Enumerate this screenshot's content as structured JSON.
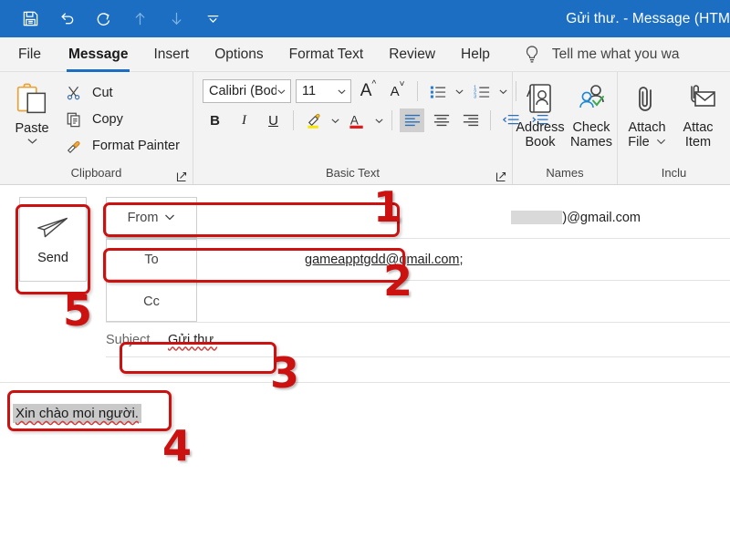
{
  "window": {
    "title": "Gửi thư.  -  Message (HTM",
    "titlebar_color": "#1b6ec2",
    "quick_access": [
      {
        "name": "save-icon",
        "label": "Save"
      },
      {
        "name": "undo-icon",
        "label": "Undo"
      },
      {
        "name": "redo-icon",
        "label": "Redo"
      },
      {
        "name": "previous-item-icon",
        "label": "Previous Item"
      },
      {
        "name": "next-item-icon",
        "label": "Next Item"
      },
      {
        "name": "customize-quick-access-toolbar-icon",
        "label": "Customize Quick Access Toolbar"
      }
    ]
  },
  "tabs": [
    {
      "label": "File",
      "active": false
    },
    {
      "label": "Message",
      "active": true
    },
    {
      "label": "Insert",
      "active": false
    },
    {
      "label": "Options",
      "active": false
    },
    {
      "label": "Format Text",
      "active": false
    },
    {
      "label": "Review",
      "active": false
    },
    {
      "label": "Help",
      "active": false
    }
  ],
  "tellme": {
    "placeholder": "Tell me what you wa",
    "icon": "lightbulb-icon"
  },
  "ribbon": {
    "groups": [
      {
        "label": "Clipboard",
        "has_launcher": true,
        "paste": {
          "label": "Paste",
          "icon": "clipboard-icon"
        },
        "items": [
          {
            "label": "Cut",
            "icon": "scissors-icon"
          },
          {
            "label": "Copy",
            "icon": "copy-icon"
          },
          {
            "label": "Format Painter",
            "icon": "paintbrush-icon"
          }
        ]
      },
      {
        "label": "Basic Text",
        "has_launcher": true,
        "font_name": "Calibri (Bod",
        "font_size": "11",
        "buttons": [
          {
            "name": "grow-font-button",
            "label": "A"
          },
          {
            "name": "shrink-font-button",
            "label": "A"
          },
          {
            "name": "bullets-button",
            "label": ""
          },
          {
            "name": "numbering-button",
            "label": ""
          },
          {
            "name": "clear-formatting-button",
            "label": "A"
          },
          {
            "name": "bold-button",
            "label": "B"
          },
          {
            "name": "italic-button",
            "label": "I"
          },
          {
            "name": "underline-button",
            "label": "U"
          },
          {
            "name": "text-highlight-color-button",
            "label": ""
          },
          {
            "name": "font-color-button",
            "label": "A"
          },
          {
            "name": "align-left-button",
            "label": ""
          },
          {
            "name": "align-center-button",
            "label": ""
          },
          {
            "name": "align-right-button",
            "label": ""
          },
          {
            "name": "decrease-indent-button",
            "label": ""
          },
          {
            "name": "increase-indent-button",
            "label": ""
          }
        ]
      },
      {
        "label": "Names",
        "has_launcher": false,
        "items": [
          {
            "label": "Address\nBook",
            "line1": "Address",
            "line2": "Book",
            "icon": "address-book-icon"
          },
          {
            "label": "Check\nNames",
            "line1": "Check",
            "line2": "Names",
            "icon": "check-names-icon"
          }
        ]
      },
      {
        "label": "Inclu",
        "has_launcher": false,
        "items": [
          {
            "line1": "Attach",
            "line2": "File",
            "icon": "paperclip-icon",
            "has_chevron": true
          },
          {
            "line1": "Attac",
            "line2": "Item",
            "icon": "attach-item-icon",
            "has_chevron": false
          }
        ]
      }
    ]
  },
  "compose": {
    "send_button": {
      "label": "Send",
      "icon": "send-arrow-icon"
    },
    "fields": [
      {
        "name": "from",
        "label": "From",
        "has_chevron": true,
        "value_suffix": ")@gmail.com",
        "redacted": true
      },
      {
        "name": "to",
        "label": "To",
        "has_chevron": false,
        "value": "gameapptgdd@gmail.com;",
        "redacted": false
      },
      {
        "name": "cc",
        "label": "Cc",
        "has_chevron": false,
        "value": "",
        "redacted": false
      }
    ],
    "subject": {
      "label": "Subject",
      "value": "Gửi thư."
    },
    "body": {
      "text": "Xin chào moi người."
    }
  },
  "annotations": {
    "color": "#cc1111",
    "markers": [
      {
        "id": "1",
        "target": "from-field"
      },
      {
        "id": "2",
        "target": "to-field"
      },
      {
        "id": "3",
        "target": "subject-field"
      },
      {
        "id": "4",
        "target": "message-body"
      },
      {
        "id": "5",
        "target": "send-button"
      }
    ]
  }
}
